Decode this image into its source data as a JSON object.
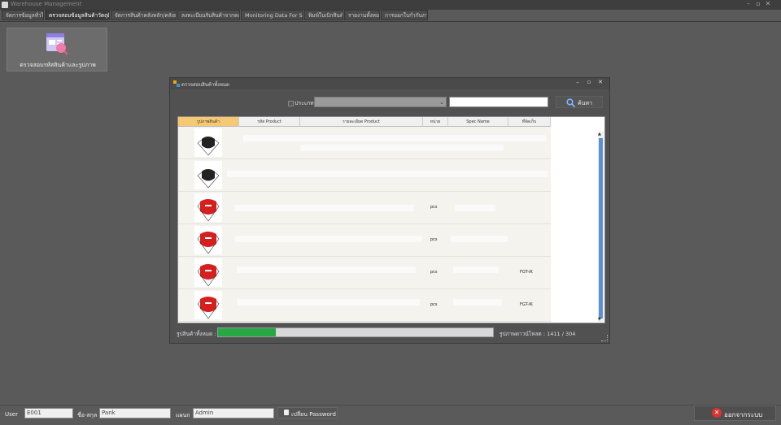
{
  "app": {
    "title": "Warehouse Management"
  },
  "tabs": [
    {
      "label": "จัดการข้อมูลทั่วไป"
    },
    {
      "label": "ตรวจสอบข้อมูลสินค้าวัตถุดิบ"
    },
    {
      "label": "จัดการสินค้าคลังหลัก/คลังย่อย"
    },
    {
      "label": "ลงทะเบียนรับสินค้าจากคลัง"
    },
    {
      "label": "Monitoring Data For Store"
    },
    {
      "label": "พิมพ์ใบเบิกสินค้า"
    },
    {
      "label": "รายงานทั้งหมด"
    },
    {
      "label": "การออกใบกำกับภาษี"
    }
  ],
  "tile": {
    "label": "ตรวจสอบรหัสสินค้าและรูปภาพ"
  },
  "dialog": {
    "title": "ตรวจสอบสินค้าทั้งหมด",
    "filter_label": "ประเภท",
    "search_value": "",
    "search_button": "ค้นหา",
    "columns": [
      "รูปภาพสินค้า",
      "รหัส Product",
      "รายละเอียด Product",
      "หน่วย",
      "Spec Name",
      "ที่จัดเก็บ"
    ],
    "rows": [
      {
        "mask": "black",
        "unit": "",
        "location": ""
      },
      {
        "mask": "black",
        "unit": "",
        "location": ""
      },
      {
        "mask": "red",
        "unit": "pcs",
        "location": ""
      },
      {
        "mask": "red",
        "unit": "pcs",
        "location": ""
      },
      {
        "mask": "red",
        "unit": "pcs",
        "location": "FGT-IK"
      },
      {
        "mask": "red",
        "unit": "pcs",
        "location": "FGT-IK"
      }
    ],
    "progress_label": "รูปสินค้าทั้งหมด :",
    "progress_fraction": 0.21,
    "download_label": "รูปภาพดาวน์โหลด : 1411 / 304"
  },
  "status": {
    "user_label": "User",
    "user_value": "E001",
    "name_label": "ชื่อ-สกุล",
    "name_value": "Pank",
    "dept_label": "แผนก",
    "dept_value": "Admin",
    "change_password": "เปลี่ยน Password",
    "exit": "ออกจากระบบ"
  },
  "colors": {
    "accent_progress": "#28a745",
    "selected_header": "#f7c873",
    "exit_icon": "#d9322f"
  }
}
